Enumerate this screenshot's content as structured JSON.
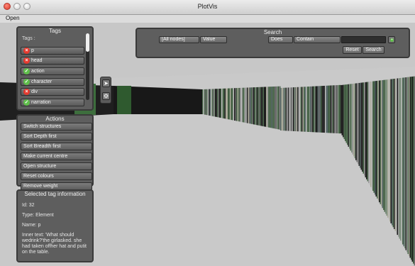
{
  "window": {
    "title": "PlotVis"
  },
  "menu": {
    "open_label": "Open"
  },
  "tags_panel": {
    "title": "Tags",
    "tags_label": "Tags :",
    "tags": [
      {
        "name": "p",
        "state": "excluded"
      },
      {
        "name": "head",
        "state": "excluded"
      },
      {
        "name": "action",
        "state": "included"
      },
      {
        "name": "character",
        "state": "included"
      },
      {
        "name": "div",
        "state": "excluded"
      },
      {
        "name": "narration",
        "state": "included"
      }
    ]
  },
  "tools": {
    "pointer_icon": "arrow-cursor-icon",
    "settings_icon": "gear-icon"
  },
  "actions_panel": {
    "title": "Actions",
    "items": [
      "Switch structures",
      "Sort Depth first",
      "Sort Breadth first",
      "Make current centre",
      "Open structure",
      "Reset colours",
      "Remove weight"
    ]
  },
  "info_panel": {
    "title": "Selected tag information",
    "id_line": "Id: 32",
    "type_line": "Type: Element",
    "name_line": "Name: p",
    "inner_text_lines": [
      "Inner text: 'What should",
      "wedrink?'the girlasked. she",
      "had taken offher hat and putit",
      "on the table."
    ]
  },
  "search": {
    "title": "Search",
    "node_select": "[All nodes]",
    "field_select": "Value",
    "op_select": "Does",
    "match_select": "Contain",
    "query_value": "",
    "reset_label": "Reset",
    "search_label": "Search",
    "add_icon": "plus-circle-icon"
  },
  "colors": {
    "excluded": "#e53a2f",
    "included": "#5fbe4a",
    "panel": "#5e5e5e",
    "background": "#c8c8c8"
  }
}
